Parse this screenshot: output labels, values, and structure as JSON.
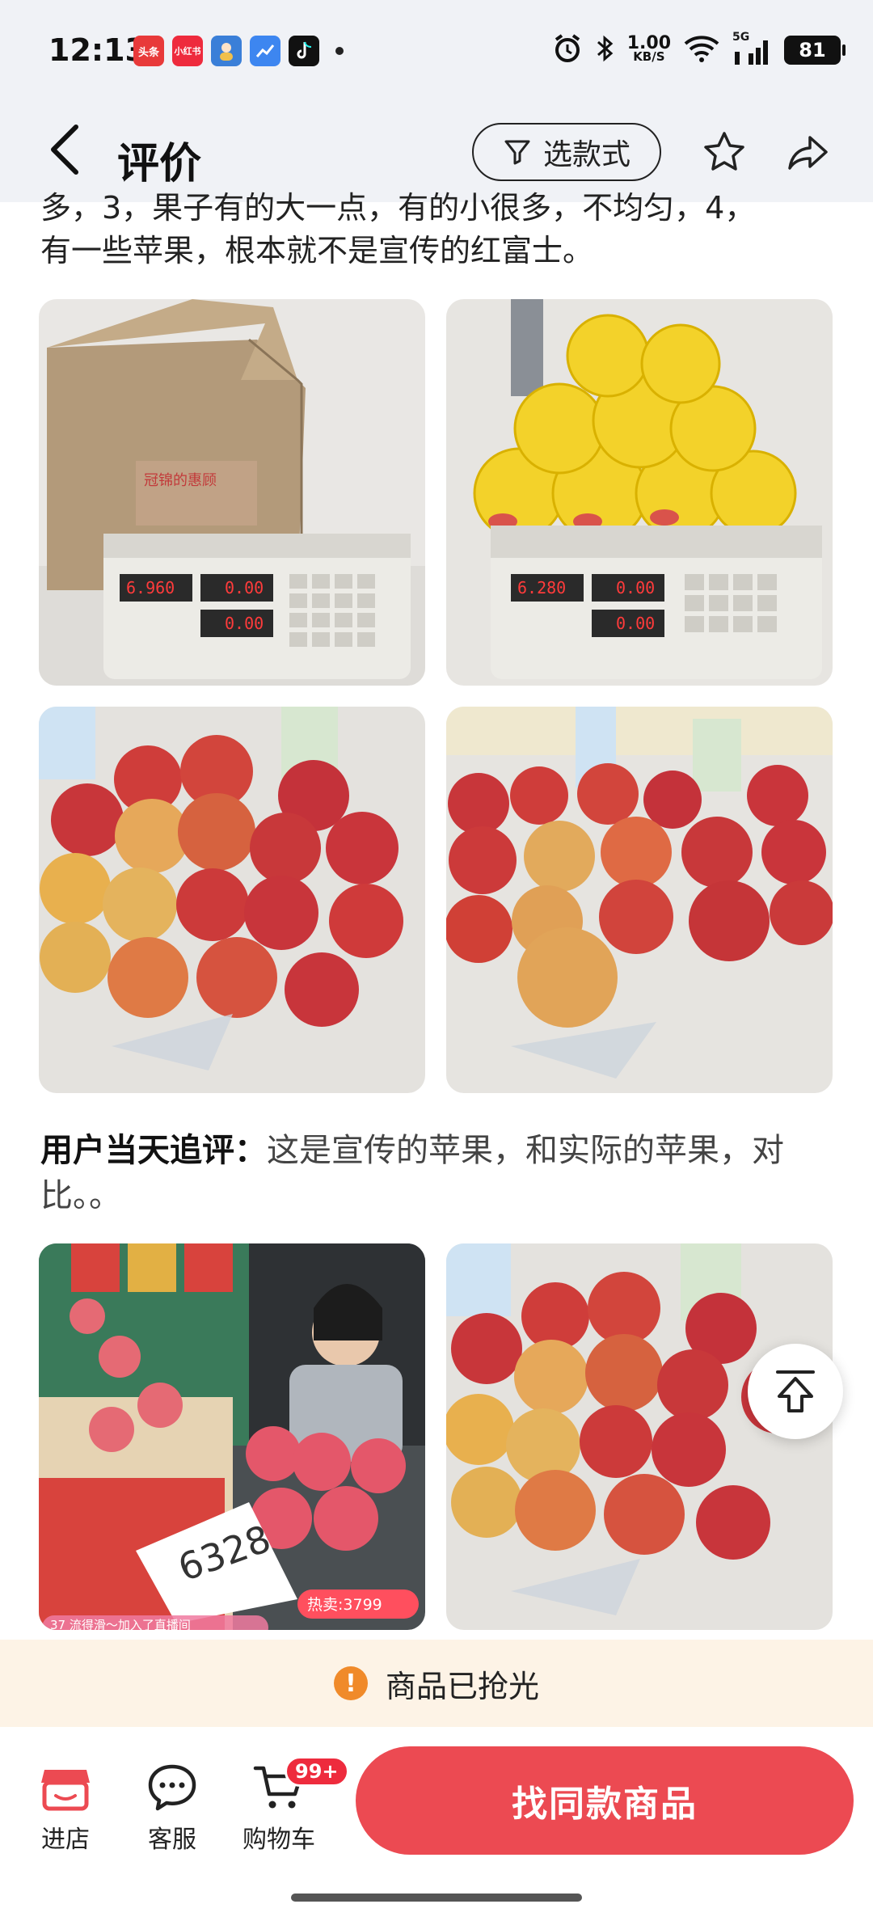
{
  "status_bar": {
    "time": "12:13",
    "app_icons": [
      {
        "name": "toutiao-icon",
        "label": "头条",
        "color": "#e83a3a"
      },
      {
        "name": "xiaohongshu-icon",
        "label": "小红书",
        "color": "#ee2b3d"
      },
      {
        "name": "avatar-app-icon",
        "label": "",
        "color": "#3a7fd8"
      },
      {
        "name": "chart-app-icon",
        "label": "",
        "color": "#3d86f0"
      },
      {
        "name": "tiktok-icon",
        "label": "",
        "color": "#111111"
      }
    ],
    "network_speed_value": "1.00",
    "network_speed_unit": "KB/S",
    "signal_label": "5G",
    "battery": "81"
  },
  "header": {
    "title": "评价",
    "filter_label": "选款式"
  },
  "review": {
    "cut_line": "多，3，果子有的大一点，有的小很多，不均匀，4，",
    "line": "有一些苹果，根本就不是宣传的红富士。"
  },
  "followup": {
    "label": "用户当天追评：",
    "text": "这是宣传的苹果，和实际的苹果，对比。。"
  },
  "photos": {
    "scale1_readout": "6.960",
    "scale1_zero1": "0.00",
    "scale1_zero2": "0.00",
    "box_print": "冠锦的惠顾",
    "scale2_readout": "6.280",
    "scale2_zero1": "0.00",
    "scale2_zero2": "0.00",
    "sign_number": "6328",
    "hot_sale": "热卖:3799",
    "live_join": "37 流得滑～加入了直播间"
  },
  "notice": {
    "text": "商品已抢光"
  },
  "bottom_nav": {
    "shop": "进店",
    "service": "客服",
    "cart": "购物车",
    "cart_badge": "99+",
    "cta": "找同款商品"
  },
  "colors": {
    "accent": "#ec4a52",
    "header_bg": "#f0f2f6",
    "notice_bg": "#fdf3e6",
    "warn": "#f08a2a"
  }
}
